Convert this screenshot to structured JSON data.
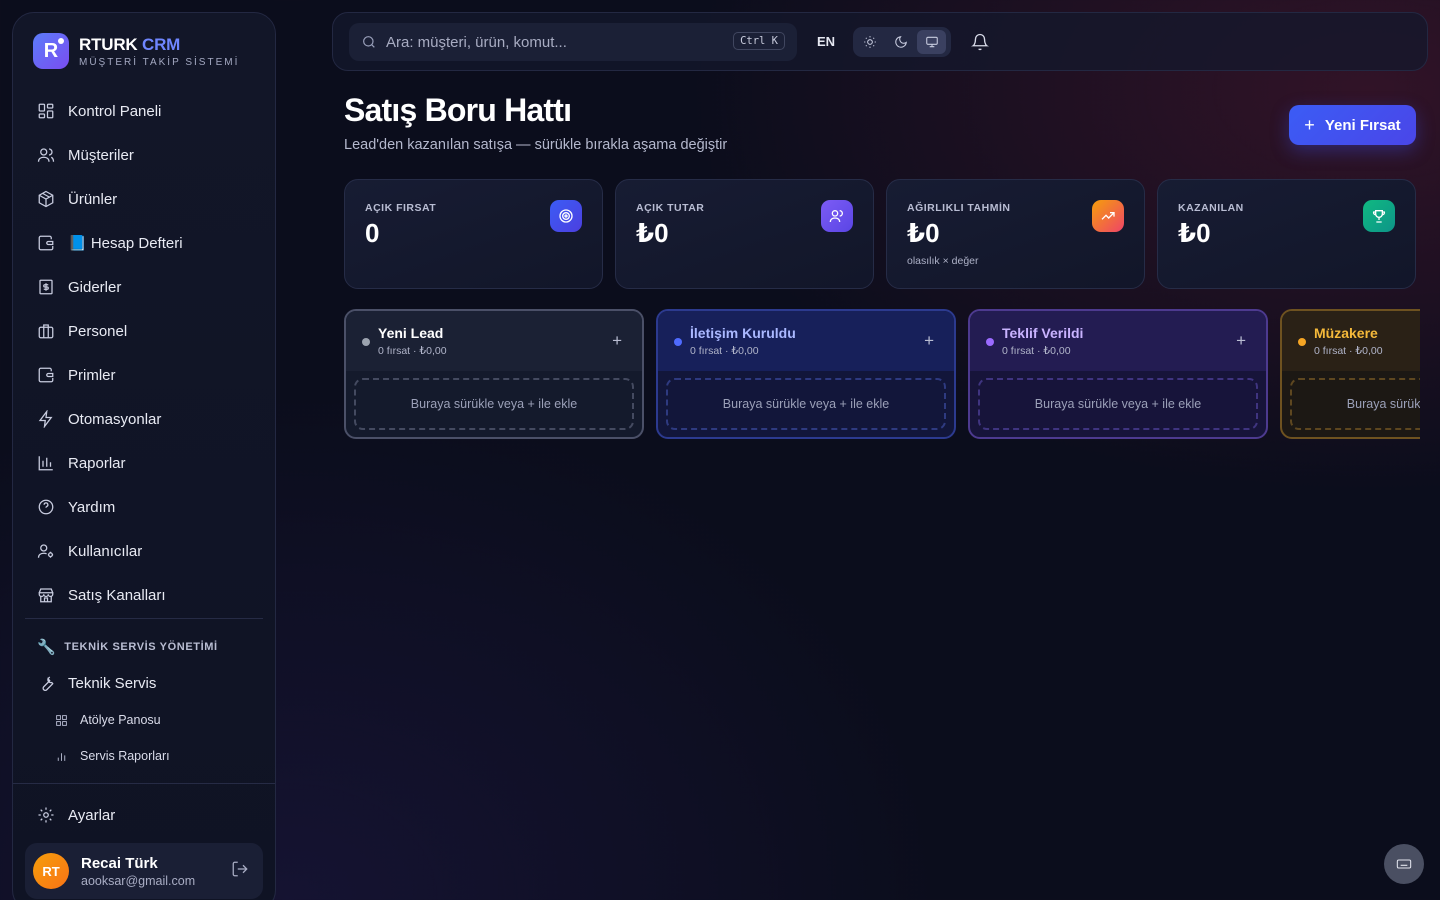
{
  "brand": {
    "title_main": "RTURK",
    "title_accent": "CRM",
    "subtitle": "MÜŞTERİ TAKİP SİSTEMİ",
    "logo_letter": "R"
  },
  "sidebar": {
    "items": [
      {
        "label": "Kontrol Paneli",
        "icon": "dashboard-icon"
      },
      {
        "label": "Müşteriler",
        "icon": "users-icon"
      },
      {
        "label": "Ürünler",
        "icon": "package-icon"
      },
      {
        "label": "📘 Hesap Defteri",
        "icon": "wallet-icon"
      },
      {
        "label": "Giderler",
        "icon": "receipt-icon"
      },
      {
        "label": "Personel",
        "icon": "briefcase-icon"
      },
      {
        "label": "Primler",
        "icon": "wallet-icon"
      },
      {
        "label": "Otomasyonlar",
        "icon": "zap-icon"
      },
      {
        "label": "Raporlar",
        "icon": "bar-chart-icon"
      },
      {
        "label": "Yardım",
        "icon": "help-circle-icon"
      },
      {
        "label": "Kullanıcılar",
        "icon": "user-cog-icon"
      },
      {
        "label": "Satış Kanalları",
        "icon": "store-icon"
      }
    ],
    "section_label": "TEKNİK SERVİS YÖNETİMİ",
    "service_item": "Teknik Servis",
    "sub_items": [
      {
        "label": "Atölye Panosu",
        "icon": "grid-icon"
      },
      {
        "label": "Servis Raporları",
        "icon": "bar-chart-icon"
      }
    ],
    "settings": "Ayarlar",
    "user": {
      "initials": "RT",
      "name": "Recai Türk",
      "email": "aooksar@gmail.com"
    }
  },
  "topbar": {
    "search_placeholder": "Ara: müşteri, ürün, komut...",
    "shortcut": "Ctrl K",
    "language": "EN",
    "theme_modes": [
      "light",
      "dark",
      "system"
    ],
    "theme_selected": "system"
  },
  "header": {
    "title": "Satış Boru Hattı",
    "subtitle": "Lead'den kazanılan satışa — sürükle bırakla aşama değiştir",
    "new_button": "Yeni Fırsat"
  },
  "stats": [
    {
      "label": "AÇIK FIRSAT",
      "value": "0",
      "note": "",
      "icon": "target-icon",
      "color": "#3b5cf5"
    },
    {
      "label": "AÇIK TUTAR",
      "value": "₺0",
      "note": "",
      "icon": "users-icon",
      "color": "#7c5cf5"
    },
    {
      "label": "AĞIRLIKLI TAHMİN",
      "value": "₺0",
      "note": "olasılık × değer",
      "icon": "trending-up-icon",
      "color": "#f0623a"
    },
    {
      "label": "KAZANILAN",
      "value": "₺0",
      "note": "",
      "icon": "trophy-icon",
      "color": "#10a37f"
    }
  ],
  "pipeline": {
    "drop_hint": "Buraya sürükle veya + ile ekle",
    "stages": [
      {
        "title": "Yeni Lead",
        "meta": "0 fırsat · ₺0,00",
        "color": "#9ca3af",
        "border": "#4b5068",
        "title_color": "#ffffff"
      },
      {
        "title": "İletişim Kuruldu",
        "meta": "0 fırsat · ₺0,00",
        "color": "#4f6bff",
        "border": "#2c3a8f",
        "title_color": "#aab8ff"
      },
      {
        "title": "Teklif Verildi",
        "meta": "0 fırsat · ₺0,00",
        "color": "#9b6bff",
        "border": "#4d3a8f",
        "title_color": "#c9b3ff"
      },
      {
        "title": "Müzakere",
        "meta": "0 fırsat · ₺0,00",
        "color": "#f5a524",
        "border": "#6e5220",
        "title_color": "#f5b93a"
      }
    ]
  }
}
